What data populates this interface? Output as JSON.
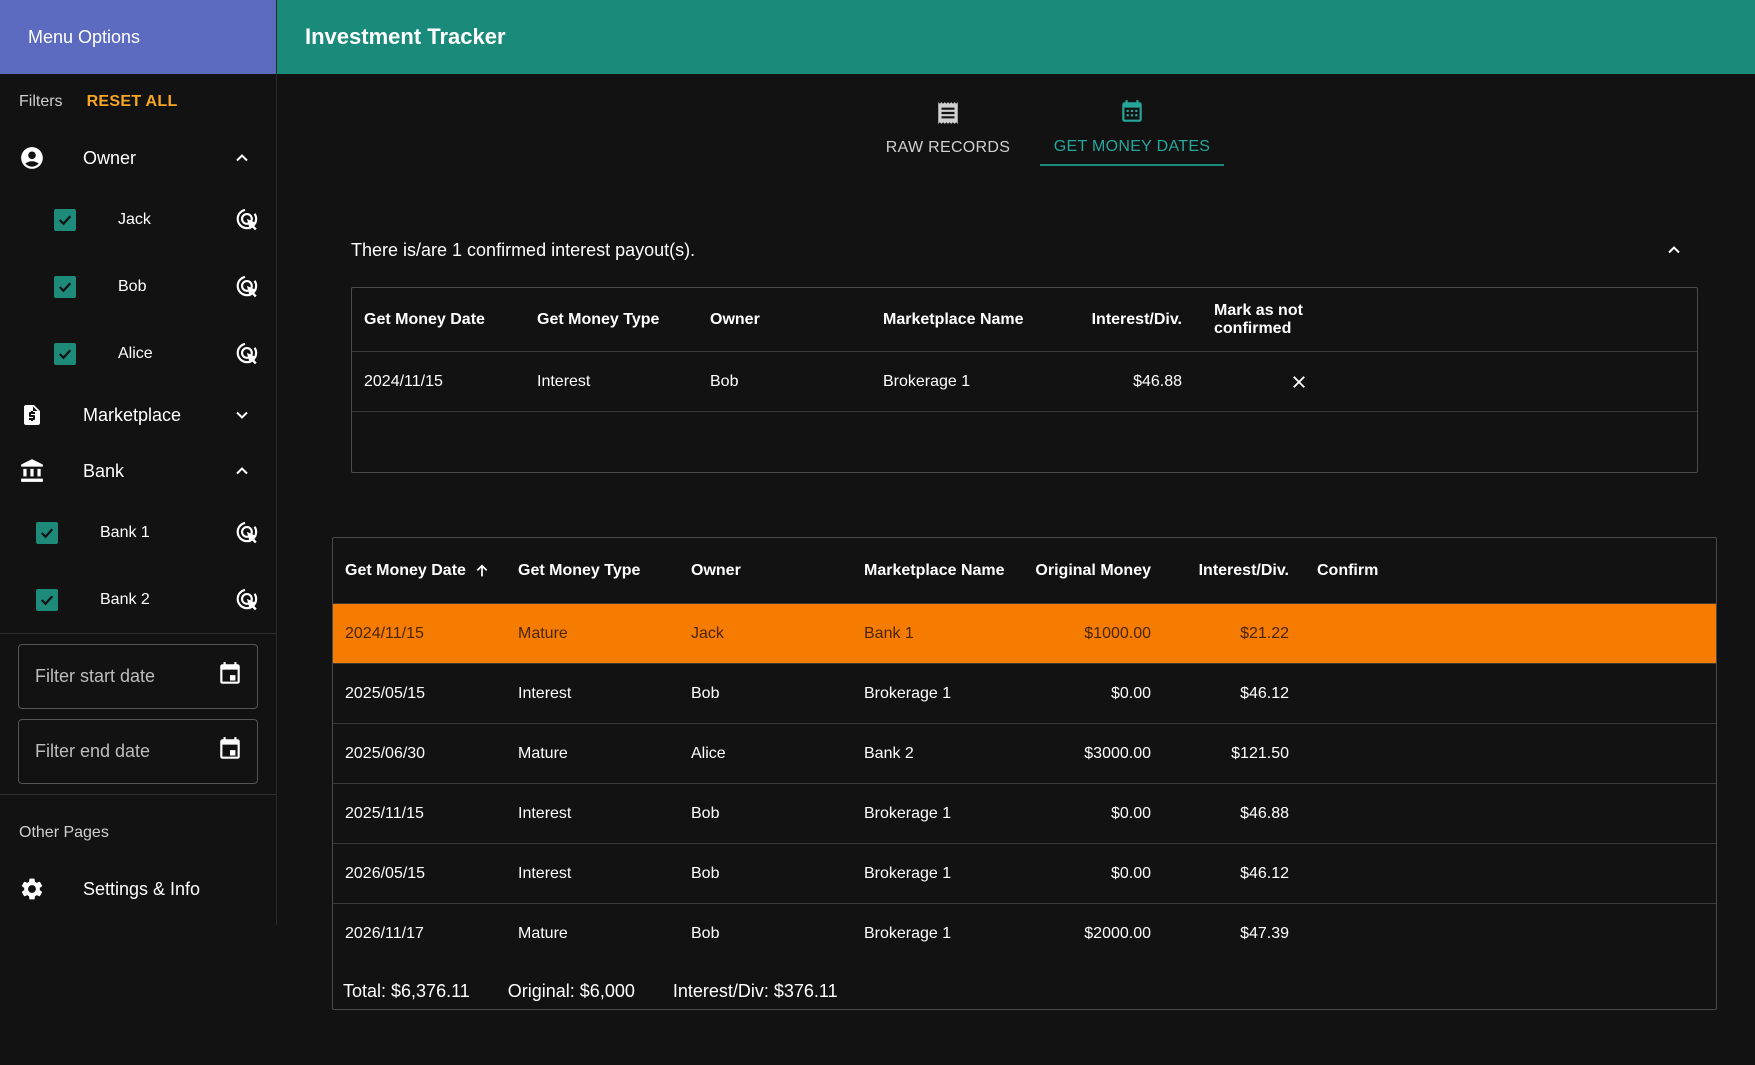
{
  "sidebar": {
    "header": "Menu Options",
    "filters_label": "Filters",
    "reset_all": "RESET ALL",
    "groups": {
      "owner": {
        "label": "Owner",
        "items": [
          {
            "label": "Jack",
            "checked": true
          },
          {
            "label": "Bob",
            "checked": true
          },
          {
            "label": "Alice",
            "checked": true
          }
        ]
      },
      "marketplace": {
        "label": "Marketplace"
      },
      "bank": {
        "label": "Bank",
        "items": [
          {
            "label": "Bank 1",
            "checked": true
          },
          {
            "label": "Bank 2",
            "checked": true
          }
        ]
      }
    },
    "start_date_placeholder": "Filter start date",
    "end_date_placeholder": "Filter end date",
    "other_pages_label": "Other Pages",
    "settings_label": "Settings & Info"
  },
  "topbar": {
    "title": "Investment Tracker"
  },
  "tabs": [
    {
      "label": "RAW RECORDS",
      "icon": "receipt-icon",
      "active": false
    },
    {
      "label": "GET MONEY DATES",
      "icon": "calendar-icon",
      "active": true
    }
  ],
  "confirmed": {
    "summary": "There is/are 1 confirmed interest payout(s).",
    "headers": [
      "Get Money Date",
      "Get Money Type",
      "Owner",
      "Marketplace Name",
      "Interest/Div.",
      "Mark as not confirmed"
    ],
    "rows": [
      {
        "date": "2024/11/15",
        "type": "Interest",
        "owner": "Bob",
        "marketplace": "Brokerage 1",
        "interest": "$46.88"
      }
    ]
  },
  "main_table": {
    "headers": [
      "Get Money Date",
      "Get Money Type",
      "Owner",
      "Marketplace Name",
      "Original Money",
      "Interest/Div.",
      "Confirm"
    ],
    "rows": [
      {
        "date": "2024/11/15",
        "type": "Mature",
        "owner": "Jack",
        "marketplace": "Bank 1",
        "original": "$1000.00",
        "interest": "$21.22",
        "highlight": true
      },
      {
        "date": "2025/05/15",
        "type": "Interest",
        "owner": "Bob",
        "marketplace": "Brokerage 1",
        "original": "$0.00",
        "interest": "$46.12"
      },
      {
        "date": "2025/06/30",
        "type": "Mature",
        "owner": "Alice",
        "marketplace": "Bank 2",
        "original": "$3000.00",
        "interest": "$121.50"
      },
      {
        "date": "2025/11/15",
        "type": "Interest",
        "owner": "Bob",
        "marketplace": "Brokerage 1",
        "original": "$0.00",
        "interest": "$46.88"
      },
      {
        "date": "2026/05/15",
        "type": "Interest",
        "owner": "Bob",
        "marketplace": "Brokerage 1",
        "original": "$0.00",
        "interest": "$46.12"
      },
      {
        "date": "2026/11/17",
        "type": "Mature",
        "owner": "Bob",
        "marketplace": "Brokerage 1",
        "original": "$2000.00",
        "interest": "$47.39"
      }
    ],
    "totals": {
      "total": "Total: $6,376.11",
      "original": "Original: $6,000",
      "interest": "Interest/Div: $376.11"
    }
  },
  "colors": {
    "sidebar_header": "#5c6bc0",
    "topbar": "#1a8a7a",
    "accent": "#26a69a",
    "reset": "#f5a623",
    "highlight_row": "#f57c00",
    "background": "#121212"
  }
}
